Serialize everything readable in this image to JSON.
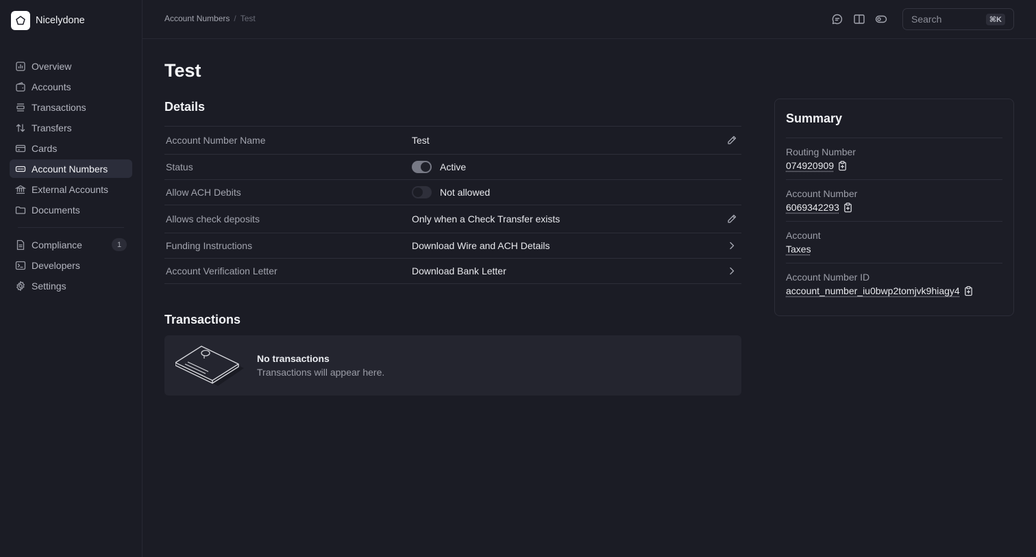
{
  "brand": {
    "name": "Nicelydone"
  },
  "sidebar": {
    "items": [
      {
        "label": "Overview"
      },
      {
        "label": "Accounts"
      },
      {
        "label": "Transactions"
      },
      {
        "label": "Transfers"
      },
      {
        "label": "Cards"
      },
      {
        "label": "Account Numbers"
      },
      {
        "label": "External Accounts"
      },
      {
        "label": "Documents"
      }
    ],
    "secondary": [
      {
        "label": "Compliance",
        "badge": "1"
      },
      {
        "label": "Developers"
      },
      {
        "label": "Settings"
      }
    ]
  },
  "header": {
    "breadcrumb": {
      "parent": "Account Numbers",
      "separator": "/",
      "current": "Test"
    },
    "search": {
      "placeholder": "Search",
      "shortcut": "⌘K"
    }
  },
  "page": {
    "title": "Test"
  },
  "details": {
    "title": "Details",
    "rows": [
      {
        "label": "Account Number Name",
        "value": "Test"
      },
      {
        "label": "Status",
        "value": "Active"
      },
      {
        "label": "Allow ACH Debits",
        "value": "Not allowed"
      },
      {
        "label": "Allows check deposits",
        "value": "Only when a Check Transfer exists"
      },
      {
        "label": "Funding Instructions",
        "value": "Download Wire and ACH Details"
      },
      {
        "label": "Account Verification Letter",
        "value": "Download Bank Letter"
      }
    ]
  },
  "transactions": {
    "title": "Transactions",
    "empty_title": "No transactions",
    "empty_subtitle": "Transactions will appear here."
  },
  "summary": {
    "title": "Summary",
    "items": [
      {
        "label": "Routing Number",
        "value": "074920909"
      },
      {
        "label": "Account Number",
        "value": "6069342293"
      },
      {
        "label": "Account",
        "value": "Taxes"
      },
      {
        "label": "Account Number ID",
        "value": "account_number_iu0bwp2tomjvk9hiagy4"
      }
    ]
  },
  "colors": {
    "background": "#1b1c25",
    "card": "#24252f",
    "border": "#2d2e39",
    "toggle_on": "#777985"
  }
}
